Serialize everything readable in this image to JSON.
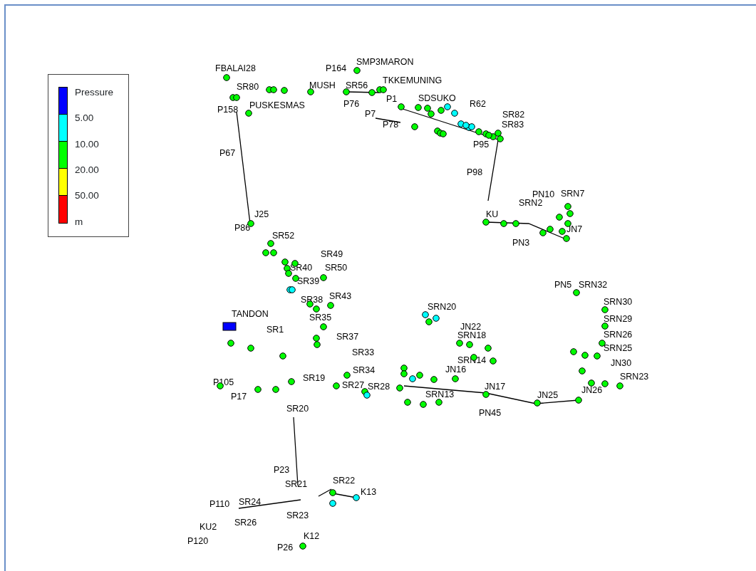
{
  "legend": {
    "title": "Pressure",
    "breaks": [
      "5.00",
      "10.00",
      "20.00",
      "50.00"
    ],
    "unit": "m",
    "ranges": [
      {
        "color": "#0000ff"
      },
      {
        "color": "#00ffff"
      },
      {
        "color": "#00ff00"
      },
      {
        "color": "#ffff00"
      },
      {
        "color": "#ff0000"
      }
    ]
  },
  "labels": [
    "FBALAI28",
    "P164",
    "SMP3MARON",
    "SR80",
    "MUSH",
    "SR56",
    "TKKEMUNING",
    "PUSKESMAS",
    "P158",
    "P76",
    "P1",
    "SDSUKO",
    "R62",
    "P7",
    "P78",
    "SR82",
    "SR83",
    "P95",
    "P67",
    "P98",
    "PN10",
    "SRN7",
    "SRN2",
    "KU",
    "JN7",
    "PN3",
    "J25",
    "P86",
    "SR52",
    "SR49",
    "SR40",
    "SR50",
    "SR39",
    "SR43",
    "SR38",
    "TANDON",
    "SR35",
    "SR1",
    "SR37",
    "SR33",
    "P105",
    "SR19",
    "SR34",
    "SR27",
    "SR28",
    "P17",
    "SR20",
    "SRN20",
    "JN22",
    "SRN18",
    "SRN14",
    "JN16",
    "SRN13",
    "JN17",
    "PN45",
    "JN25",
    "JN26",
    "PN5",
    "SRN32",
    "SRN30",
    "SRN29",
    "SRN26",
    "SRN25",
    "JN30",
    "SRN23",
    "P23",
    "SR21",
    "SR22",
    "K13",
    "SR24",
    "P110",
    "SR23",
    "SR26",
    "KU2",
    "K12",
    "P26",
    "P120"
  ],
  "nodes": [
    {
      "kind": "junction",
      "color": "#00ff00"
    },
    {
      "kind": "junction",
      "color": "#00ff00"
    },
    {
      "kind": "junction",
      "color": "#00ff00"
    },
    {
      "kind": "junction",
      "color": "#00ff00"
    },
    {
      "kind": "junction",
      "color": "#00ff00"
    },
    {
      "kind": "junction",
      "color": "#00ff00"
    },
    {
      "kind": "junction",
      "color": "#00ff00"
    },
    {
      "kind": "junction",
      "color": "#00ff00"
    },
    {
      "kind": "junction",
      "color": "#00ff00"
    },
    {
      "kind": "junction",
      "color": "#00ff00"
    },
    {
      "kind": "junction",
      "color": "#00ff00"
    },
    {
      "kind": "junction",
      "color": "#00ff00"
    },
    {
      "kind": "junction",
      "color": "#00ff00"
    },
    {
      "kind": "junction",
      "color": "#00ff00"
    },
    {
      "kind": "junction",
      "color": "#00ff00"
    },
    {
      "kind": "junction",
      "color": "#00ff00"
    },
    {
      "kind": "junction",
      "color": "#00ffff"
    },
    {
      "kind": "junction",
      "color": "#00ffff"
    },
    {
      "kind": "junction",
      "color": "#00ffff"
    },
    {
      "kind": "junction",
      "color": "#00ffff"
    },
    {
      "kind": "junction",
      "color": "#00ff00"
    },
    {
      "kind": "junction",
      "color": "#00ff00"
    },
    {
      "kind": "junction",
      "color": "#00ff00"
    },
    {
      "kind": "junction",
      "color": "#00ff00"
    },
    {
      "kind": "junction",
      "color": "#00ff00"
    },
    {
      "kind": "junction",
      "color": "#00ff00"
    },
    {
      "kind": "junction",
      "color": "#00ff00"
    },
    {
      "kind": "junction",
      "color": "#00ff00"
    },
    {
      "kind": "junction",
      "color": "#00ffff"
    },
    {
      "kind": "junction",
      "color": "#00ffff"
    },
    {
      "kind": "junction",
      "color": "#00ff00"
    },
    {
      "kind": "junction",
      "color": "#00ff00"
    },
    {
      "kind": "junction",
      "color": "#00ff00"
    },
    {
      "kind": "junction",
      "color": "#00ff00"
    },
    {
      "kind": "junction",
      "color": "#00ff00"
    },
    {
      "kind": "junction",
      "color": "#00ff00"
    },
    {
      "kind": "junction",
      "color": "#00ff00"
    },
    {
      "kind": "junction",
      "color": "#00ff00"
    },
    {
      "kind": "junction",
      "color": "#00ff00"
    },
    {
      "kind": "junction",
      "color": "#00ff00"
    },
    {
      "kind": "junction",
      "color": "#00ff00"
    },
    {
      "kind": "junction",
      "color": "#00ff00"
    },
    {
      "kind": "junction",
      "color": "#00ff00"
    },
    {
      "kind": "junction",
      "color": "#00ff00"
    },
    {
      "kind": "junction",
      "color": "#00ff00"
    },
    {
      "kind": "junction",
      "color": "#00ff00"
    },
    {
      "kind": "junction",
      "color": "#00ff00"
    },
    {
      "kind": "junction",
      "color": "#00ff00"
    },
    {
      "kind": "junction",
      "color": "#00ff00"
    },
    {
      "kind": "junction",
      "color": "#00ff00"
    },
    {
      "kind": "junction",
      "color": "#00ff00"
    },
    {
      "kind": "junction",
      "color": "#00ff00"
    },
    {
      "kind": "junction",
      "color": "#00ff00"
    },
    {
      "kind": "junction",
      "color": "#00ff00"
    },
    {
      "kind": "junction",
      "color": "#00ff00"
    },
    {
      "kind": "junction",
      "color": "#00ffff"
    },
    {
      "kind": "junction",
      "color": "#00ffff"
    },
    {
      "kind": "junction",
      "color": "#00ff00"
    },
    {
      "kind": "junction",
      "color": "#00ff00"
    },
    {
      "kind": "junction",
      "color": "#00ff00"
    },
    {
      "kind": "junction",
      "color": "#00ff00"
    },
    {
      "kind": "junction",
      "color": "#00ff00"
    },
    {
      "kind": "junction",
      "color": "#00ff00"
    },
    {
      "kind": "junction",
      "color": "#00ff00"
    },
    {
      "kind": "junction",
      "color": "#00ff00"
    },
    {
      "kind": "junction",
      "color": "#00ff00"
    },
    {
      "kind": "junction",
      "color": "#00ff00"
    },
    {
      "kind": "junction",
      "color": "#00ff00"
    },
    {
      "kind": "junction",
      "color": "#00ff00"
    },
    {
      "kind": "junction",
      "color": "#00ff00"
    },
    {
      "kind": "junction",
      "color": "#00ff00"
    },
    {
      "kind": "junction",
      "color": "#00ff00"
    },
    {
      "kind": "junction",
      "color": "#00ff00"
    },
    {
      "kind": "junction",
      "color": "#00ff00"
    },
    {
      "kind": "junction",
      "color": "#00ffff"
    },
    {
      "kind": "junction",
      "color": "#00ffff"
    },
    {
      "kind": "junction",
      "color": "#00ffff"
    },
    {
      "kind": "junction",
      "color": "#00ffff"
    },
    {
      "kind": "junction",
      "color": "#00ff00"
    },
    {
      "kind": "junction",
      "color": "#00ff00"
    },
    {
      "kind": "junction",
      "color": "#00ff00"
    },
    {
      "kind": "junction",
      "color": "#00ffff"
    },
    {
      "kind": "junction",
      "color": "#00ffff"
    },
    {
      "kind": "junction",
      "color": "#00ff00"
    },
    {
      "kind": "tank",
      "color": "#0000ff"
    },
    {
      "kind": "junction",
      "color": "#00ff00"
    },
    {
      "kind": "junction",
      "color": "#00ff00"
    },
    {
      "kind": "junction",
      "color": "#00ff00"
    },
    {
      "kind": "junction",
      "color": "#00ff00"
    },
    {
      "kind": "junction",
      "color": "#00ff00"
    },
    {
      "kind": "junction",
      "color": "#00ff00"
    },
    {
      "kind": "junction",
      "color": "#00ff00"
    },
    {
      "kind": "junction",
      "color": "#00ff00"
    },
    {
      "kind": "junction",
      "color": "#00ff00"
    },
    {
      "kind": "junction",
      "color": "#00ff00"
    },
    {
      "kind": "junction",
      "color": "#00ff00"
    },
    {
      "kind": "junction",
      "color": "#00ff00"
    },
    {
      "kind": "junction",
      "color": "#00ff00"
    },
    {
      "kind": "junction",
      "color": "#00ff00"
    },
    {
      "kind": "junction",
      "color": "#00ff00"
    },
    {
      "kind": "junction",
      "color": "#00ff00"
    },
    {
      "kind": "junction",
      "color": "#00ff00"
    },
    {
      "kind": "junction",
      "color": "#00ff00"
    },
    {
      "kind": "junction",
      "color": "#00ff00"
    },
    {
      "kind": "junction",
      "color": "#00ff00"
    },
    {
      "kind": "junction",
      "color": "#00ff00"
    },
    {
      "kind": "junction",
      "color": "#00ff00"
    },
    {
      "kind": "junction",
      "color": "#00ff00"
    },
    {
      "kind": "junction",
      "color": "#00ff00"
    },
    {
      "kind": "junction",
      "color": "#00ff00"
    },
    {
      "kind": "junction",
      "color": "#00ff00"
    }
  ]
}
